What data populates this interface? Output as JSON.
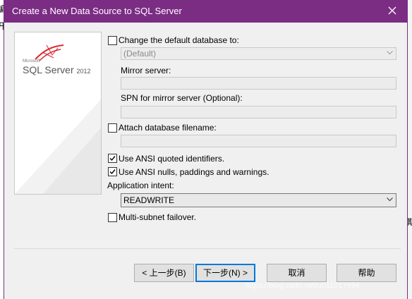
{
  "window": {
    "title": "Create a New Data Source to SQL Server"
  },
  "banner": {
    "ms": "Microsoft",
    "product": "SQL Server",
    "version": "2012"
  },
  "form": {
    "change_db": {
      "label": "Change the default database to:",
      "checked": false
    },
    "default_db": {
      "value": "(Default)"
    },
    "mirror": {
      "label": "Mirror server:",
      "value": ""
    },
    "spn": {
      "label": "SPN for mirror server (Optional):",
      "value": ""
    },
    "attach": {
      "label": "Attach database filename:",
      "checked": false,
      "value": ""
    },
    "ansi_quoted": {
      "label": "Use ANSI quoted identifiers.",
      "checked": true
    },
    "ansi_nulls": {
      "label": "Use ANSI nulls, paddings and warnings.",
      "checked": true
    },
    "app_intent": {
      "label": "Application intent:",
      "value": "READWRITE"
    },
    "multisubnet": {
      "label": "Multi-subnet failover.",
      "checked": false
    }
  },
  "buttons": {
    "back": "< 上一步(B)",
    "next": "下一步(N) >",
    "cancel": "取消",
    "help": "帮助"
  },
  "watermark": "https://blog.csdn.net/u011017694",
  "background": {
    "frag_left_1": "编",
    "frag_left_2": "开",
    "frag_right": "期"
  }
}
